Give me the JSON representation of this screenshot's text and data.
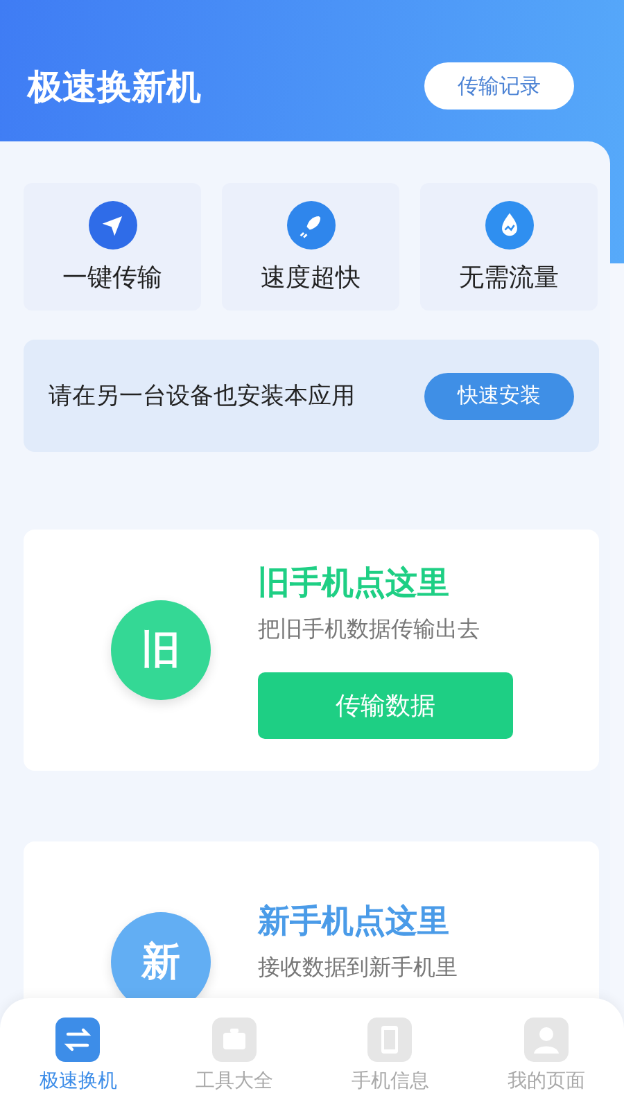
{
  "header": {
    "title": "极速换新机",
    "history_button": "传输记录"
  },
  "features": [
    {
      "kind": "send",
      "label": "一键传输"
    },
    {
      "kind": "rocket",
      "label": "速度超快"
    },
    {
      "kind": "drop",
      "label": "无需流量"
    }
  ],
  "install_banner": {
    "text": "请在另一台设备也安装本应用",
    "button": "快速安装"
  },
  "cards": [
    {
      "kind": "old",
      "badge": "旧",
      "title": "旧手机点这里",
      "subtitle": "把旧手机数据传输出去",
      "button": "传输数据"
    },
    {
      "kind": "new",
      "badge": "新",
      "title": "新手机点这里",
      "subtitle": "接收数据到新手机里"
    }
  ],
  "tab_bar": [
    {
      "kind": "swap",
      "label": "极速换机",
      "selected": true
    },
    {
      "kind": "toolbox",
      "label": "工具大全",
      "selected": false
    },
    {
      "kind": "phone",
      "label": "手机信息",
      "selected": false
    },
    {
      "kind": "user",
      "label": "我的页面",
      "selected": false
    }
  ]
}
